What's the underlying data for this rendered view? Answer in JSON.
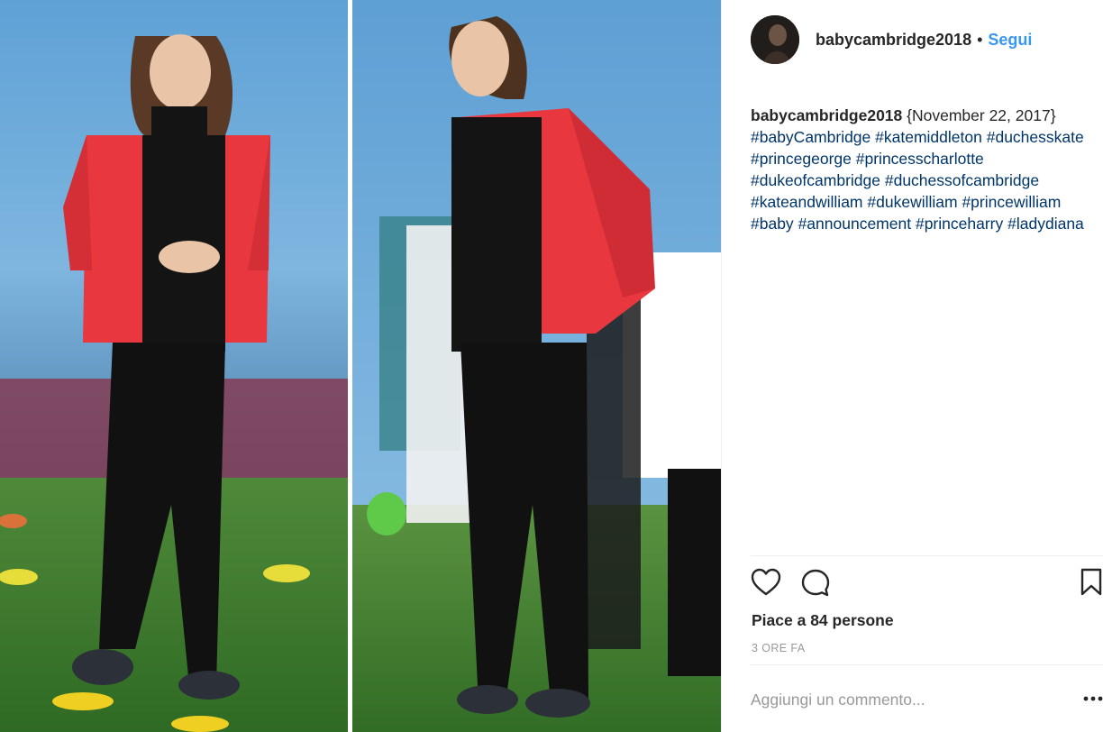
{
  "post": {
    "username": "babycambridge2018",
    "separator": "•",
    "follow_label": "Segui",
    "caption": {
      "username": "babycambridge2018",
      "text_parts": [
        {
          "type": "text",
          "value": " {November 22, 2017} "
        },
        {
          "type": "tag",
          "value": "#babyCambridge"
        },
        {
          "type": "text",
          "value": " "
        },
        {
          "type": "tag",
          "value": "#katemiddleton"
        },
        {
          "type": "text",
          "value": " "
        },
        {
          "type": "tag",
          "value": "#duchesskate"
        },
        {
          "type": "text",
          "value": " "
        },
        {
          "type": "tag",
          "value": "#princegeorge"
        },
        {
          "type": "text",
          "value": " "
        },
        {
          "type": "tag",
          "value": "#princesscharlotte"
        },
        {
          "type": "text",
          "value": " "
        },
        {
          "type": "tag",
          "value": "#dukeofcambridge"
        },
        {
          "type": "text",
          "value": " "
        },
        {
          "type": "tag",
          "value": "#duchessofcambridge"
        },
        {
          "type": "text",
          "value": " "
        },
        {
          "type": "tag",
          "value": "#kateandwilliam"
        },
        {
          "type": "text",
          "value": " "
        },
        {
          "type": "tag",
          "value": "#dukewilliam"
        },
        {
          "type": "text",
          "value": " "
        },
        {
          "type": "tag",
          "value": "#princewilliam"
        },
        {
          "type": "text",
          "value": " "
        },
        {
          "type": "tag",
          "value": "#baby"
        },
        {
          "type": "text",
          "value": " "
        },
        {
          "type": "tag",
          "value": "#announcement"
        },
        {
          "type": "text",
          "value": " "
        },
        {
          "type": "tag",
          "value": "#princeharry"
        },
        {
          "type": "text",
          "value": " "
        },
        {
          "type": "tag",
          "value": "#ladydiana"
        }
      ]
    },
    "likes_text": "Piace a 84 persone",
    "time_text": "3 ORE FA",
    "comment_placeholder": "Aggiungi un commento..."
  },
  "icons": {
    "like": "heart-icon",
    "comment": "comment-bubble-icon",
    "save": "bookmark-icon",
    "more": "more-options-icon"
  },
  "colors": {
    "link_blue": "#3897f0",
    "hashtag": "#003569",
    "text": "#262626",
    "muted": "#999999",
    "jacket_red": "#e8373f"
  }
}
